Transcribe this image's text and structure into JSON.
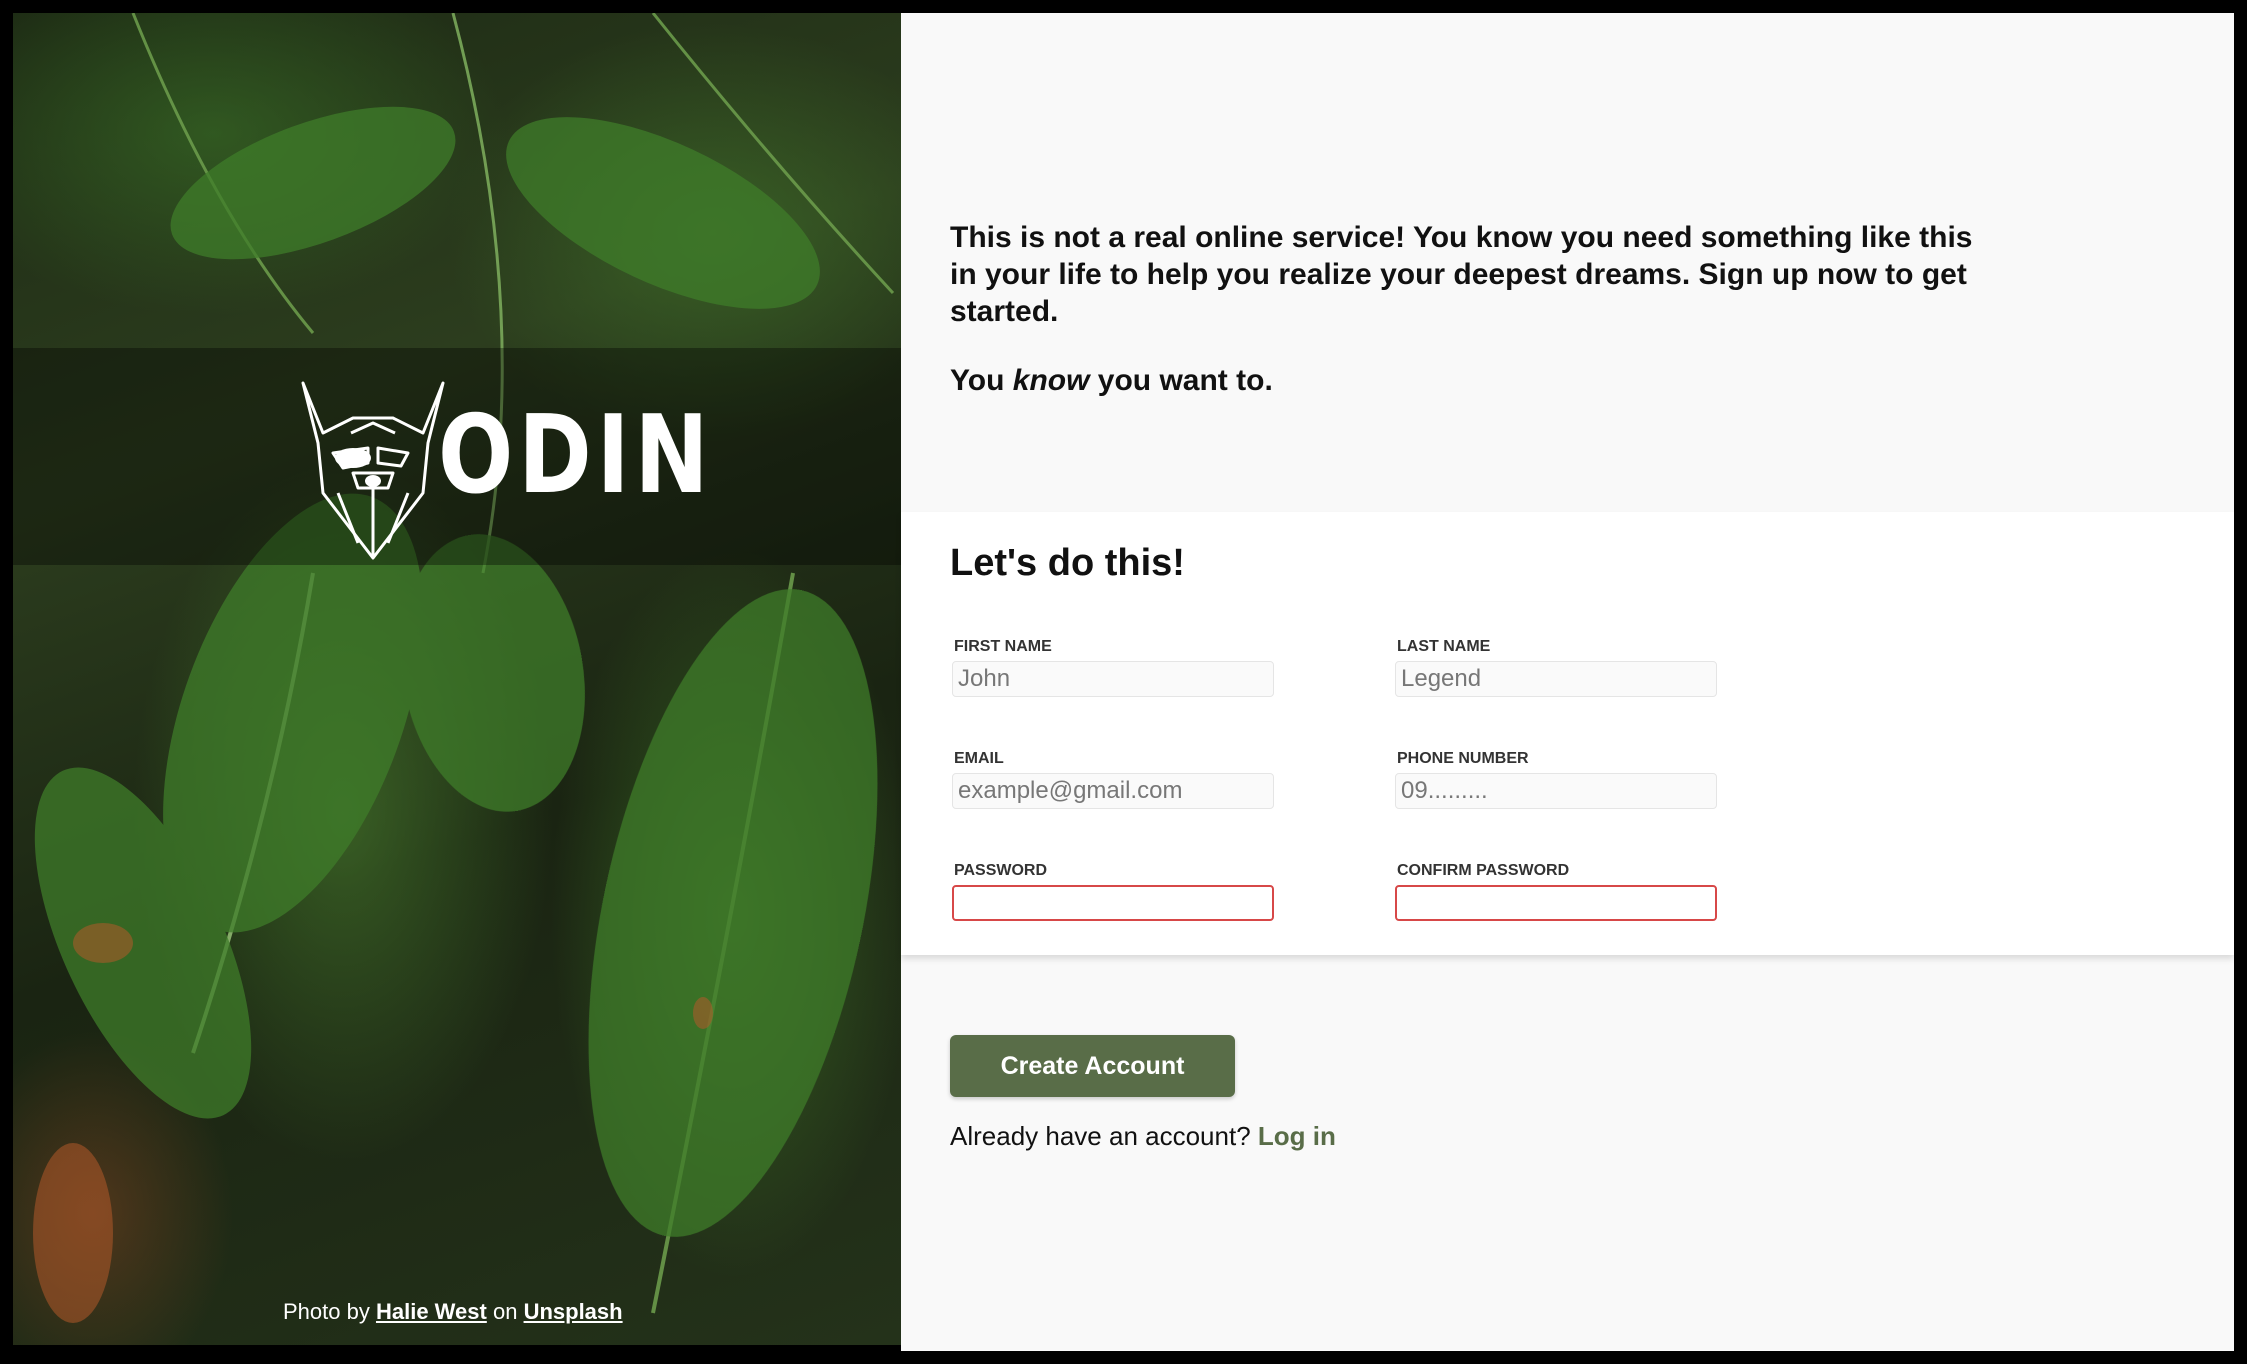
{
  "hero": {
    "brand": "ODIN",
    "photo_credit": {
      "prefix": "Photo by",
      "author": "Halie West",
      "middle": "on",
      "site": "Unsplash"
    }
  },
  "intro": {
    "paragraph1": "This is not a real online service! You know you need something like this in your life to help you realize your deepest dreams. Sign up now to get started.",
    "p2_before": "You",
    "p2_em": "know",
    "p2_after": "you want to."
  },
  "form": {
    "title": "Let's do this!",
    "fields": {
      "first_name": {
        "label": "First Name",
        "placeholder": "John",
        "value": ""
      },
      "last_name": {
        "label": "Last Name",
        "placeholder": "Legend",
        "value": ""
      },
      "email": {
        "label": "Email",
        "placeholder": "example@gmail.com",
        "value": ""
      },
      "phone": {
        "label": "Phone Number",
        "placeholder": "09.........",
        "value": ""
      },
      "password": {
        "label": "Password",
        "placeholder": "",
        "value": ""
      },
      "confirm_password": {
        "label": "Confirm Password",
        "placeholder": "",
        "value": ""
      }
    }
  },
  "actions": {
    "create_label": "Create Account",
    "login_prompt": "Already have an account?",
    "login_link": "Log in"
  },
  "colors": {
    "accent": "#596d48",
    "error_border": "#d74848",
    "panel_bg": "#f9f9f9"
  }
}
